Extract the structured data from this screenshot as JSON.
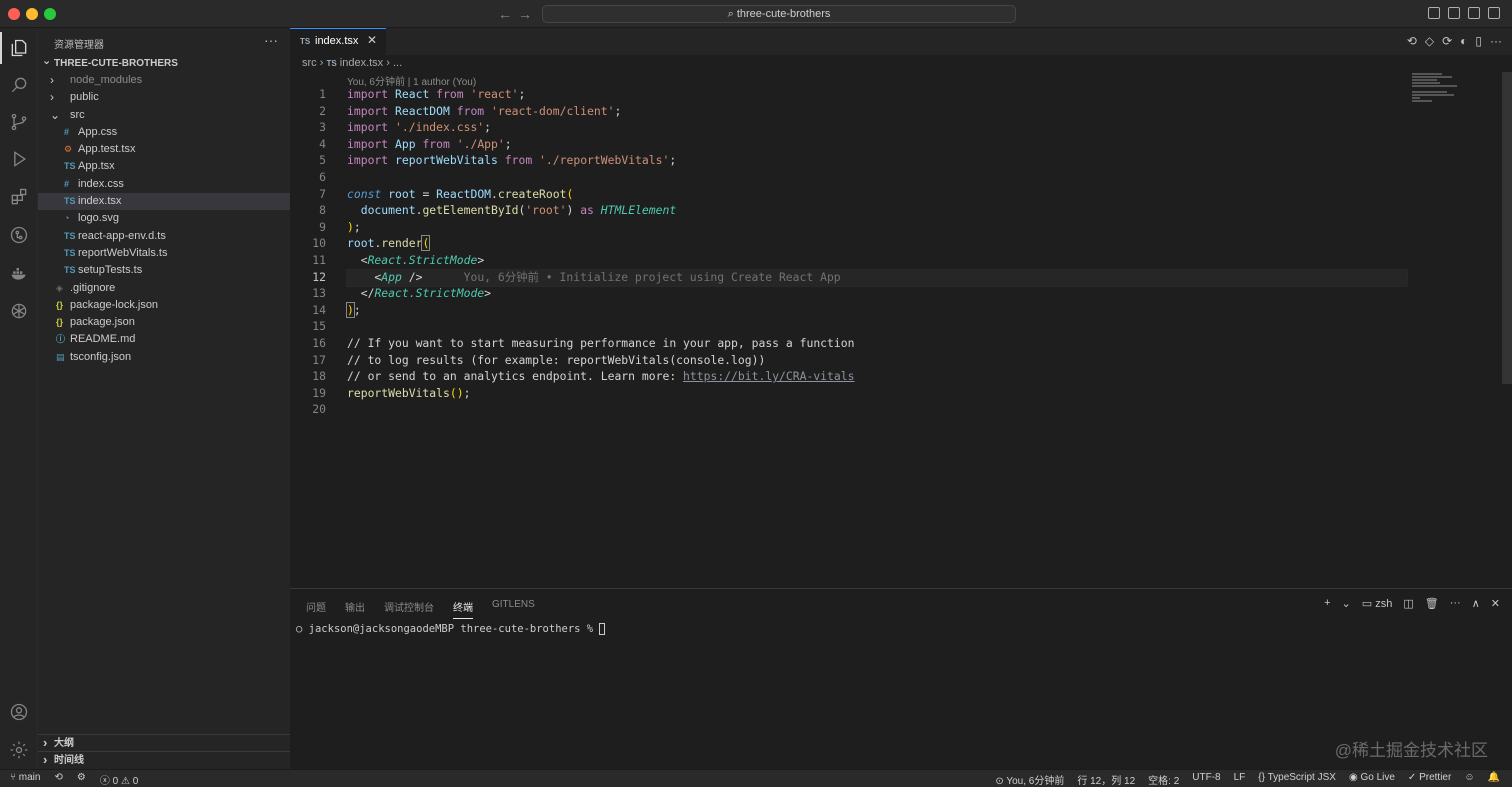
{
  "window": {
    "title": "three-cute-brothers",
    "back": "←",
    "forward": "→"
  },
  "sidebar": {
    "title": "资源管理器",
    "more": "···",
    "root": "THREE-CUTE-BROTHERS",
    "items": [
      {
        "name": "node_modules",
        "kind": "folder",
        "depth": 0,
        "dim": true
      },
      {
        "name": "public",
        "kind": "folder",
        "depth": 0
      },
      {
        "name": "src",
        "kind": "folder-open",
        "depth": 0
      },
      {
        "name": "App.css",
        "kind": "css",
        "depth": 1,
        "icon": "#"
      },
      {
        "name": "App.test.tsx",
        "kind": "test",
        "depth": 1,
        "icon": "⚙"
      },
      {
        "name": "App.tsx",
        "kind": "ts",
        "depth": 1,
        "icon": "TS"
      },
      {
        "name": "index.css",
        "kind": "css",
        "depth": 1,
        "icon": "#"
      },
      {
        "name": "index.tsx",
        "kind": "ts",
        "depth": 1,
        "icon": "TS",
        "selected": true
      },
      {
        "name": "logo.svg",
        "kind": "svg",
        "depth": 1,
        "icon": "◔"
      },
      {
        "name": "react-app-env.d.ts",
        "kind": "ts",
        "depth": 1,
        "icon": "TS"
      },
      {
        "name": "reportWebVitals.ts",
        "kind": "ts",
        "depth": 1,
        "icon": "TS"
      },
      {
        "name": "setupTests.ts",
        "kind": "ts",
        "depth": 1,
        "icon": "TS"
      },
      {
        "name": ".gitignore",
        "kind": "git",
        "depth": 0,
        "icon": "◈"
      },
      {
        "name": "package-lock.json",
        "kind": "json",
        "depth": 0,
        "icon": "{}"
      },
      {
        "name": "package.json",
        "kind": "json",
        "depth": 0,
        "icon": "{}"
      },
      {
        "name": "README.md",
        "kind": "info",
        "depth": 0,
        "icon": "ⓘ"
      },
      {
        "name": "tsconfig.json",
        "kind": "tsconfig",
        "depth": 0,
        "icon": "▤"
      }
    ],
    "outline": "大纲",
    "timeline": "时间线"
  },
  "editor": {
    "tab": {
      "icon": "TS",
      "name": "index.tsx",
      "close": "✕"
    },
    "breadcrumb": {
      "folder": "src",
      "sep": "›",
      "file": "index.tsx",
      "more": "..."
    },
    "blame_header": "You, 6分钟前 | 1 author (You)",
    "inline_blame": "You, 6分钟前 • Initialize project using Create React App",
    "lines": [
      {
        "n": "1"
      },
      {
        "n": "2"
      },
      {
        "n": "3"
      },
      {
        "n": "4"
      },
      {
        "n": "5"
      },
      {
        "n": "6"
      },
      {
        "n": "7"
      },
      {
        "n": "8"
      },
      {
        "n": "9"
      },
      {
        "n": "10"
      },
      {
        "n": "11"
      },
      {
        "n": "12"
      },
      {
        "n": "13"
      },
      {
        "n": "14"
      },
      {
        "n": "15"
      },
      {
        "n": "16"
      },
      {
        "n": "17"
      },
      {
        "n": "18"
      },
      {
        "n": "19"
      },
      {
        "n": "20"
      }
    ],
    "code": {
      "l1": [
        "import",
        " React ",
        "from",
        " 'react'",
        ";"
      ],
      "l2": [
        "import",
        " ReactDOM ",
        "from",
        " 'react-dom/client'",
        ";"
      ],
      "l3": [
        "import",
        " './index.css'",
        ";"
      ],
      "l4": [
        "import",
        " App ",
        "from",
        " './App'",
        ";"
      ],
      "l5": [
        "import",
        " reportWebVitals ",
        "from",
        " './reportWebVitals'",
        ";"
      ],
      "l7": [
        "const",
        " root ",
        "= ",
        "ReactDOM",
        ".",
        "createRoot",
        "("
      ],
      "l8": [
        "  document",
        ".",
        "getElementById",
        "(",
        "'root'",
        ") ",
        "as",
        " HTMLElement"
      ],
      "l9": [
        ")",
        ";"
      ],
      "l10": [
        "root",
        ".",
        "render",
        "("
      ],
      "l11": [
        "  <",
        "React.StrictMode",
        ">"
      ],
      "l12": [
        "    <",
        "App",
        " />"
      ],
      "l13": [
        "  </",
        "React.StrictMode",
        ">"
      ],
      "l14": [
        ")",
        ";"
      ],
      "l16": "// If you want to start measuring performance in your app, pass a function",
      "l17": "// to log results (for example: reportWebVitals(console.log))",
      "l18a": "// or send to an analytics endpoint. Learn more: ",
      "l18b": "https://bit.ly/CRA-vitals",
      "l19": [
        "reportWebVitals",
        "()",
        ";"
      ]
    }
  },
  "panel": {
    "tabs": [
      "问题",
      "输出",
      "调试控制台",
      "终端",
      "GITLENS"
    ],
    "active_tab": "终端",
    "shell": "zsh",
    "prompt": "jackson@jacksongaodeMBP three-cute-brothers % ",
    "add": "+",
    "chevron": "⌄",
    "more": "···",
    "maximize": "∧",
    "close": "✕"
  },
  "statusbar": {
    "branch": "main",
    "errors": "0",
    "warnings": "0",
    "blame": "You, 6分钟前",
    "position": "行 12，列 12",
    "spaces": "空格: 2",
    "encoding": "UTF-8",
    "eol": "LF",
    "language": "TypeScript JSX",
    "golive": "Go Live",
    "prettier": "Prettier"
  },
  "watermark": "@稀土掘金技术社区",
  "colors": {
    "accent": "#3794ff",
    "keyword": "#c586c0",
    "string": "#ce9178",
    "function": "#dcdcaa",
    "type": "#4ec9b0"
  }
}
